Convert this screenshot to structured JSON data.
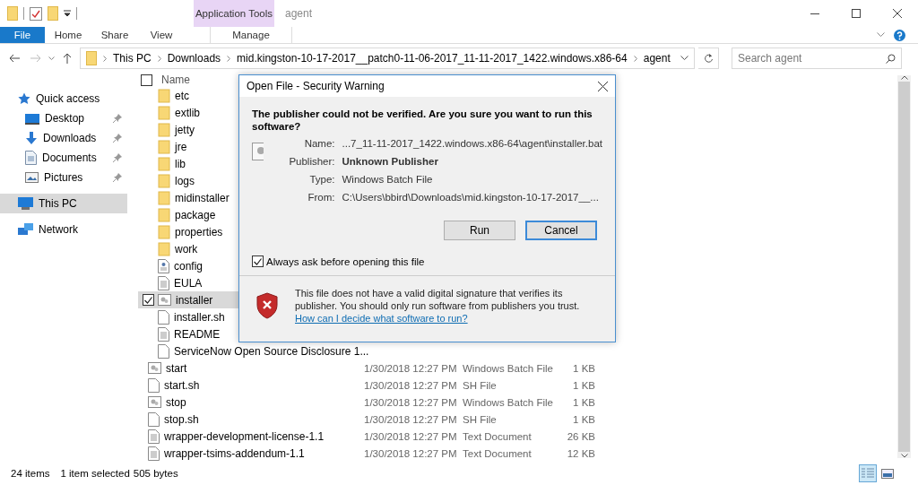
{
  "window": {
    "title": "agent",
    "context_group": "Application Tools"
  },
  "quick_access_toolbar": {
    "properties_checked": true
  },
  "ribbon_tabs": [
    {
      "label": "File",
      "kind": "file"
    },
    {
      "label": "Home",
      "kind": "tab"
    },
    {
      "label": "Share",
      "kind": "tab"
    },
    {
      "label": "View",
      "kind": "tab"
    },
    {
      "label": "Manage",
      "kind": "context"
    }
  ],
  "address_bar": {
    "path": [
      "This PC",
      "Downloads",
      "mid.kingston-10-17-2017__patch0-11-06-2017_11-11-2017_1422.windows.x86-64",
      "agent"
    ]
  },
  "search": {
    "placeholder": "Search agent"
  },
  "sidebar": {
    "items": [
      {
        "label": "Quick access",
        "kind": "star",
        "pinned": false,
        "selected": false
      },
      {
        "label": "Desktop",
        "kind": "desktop",
        "pinned": true,
        "selected": false
      },
      {
        "label": "Downloads",
        "kind": "downloads",
        "pinned": true,
        "selected": false
      },
      {
        "label": "Documents",
        "kind": "documents",
        "pinned": true,
        "selected": false
      },
      {
        "label": "Pictures",
        "kind": "pictures",
        "pinned": true,
        "selected": false
      },
      {
        "label": "This PC",
        "kind": "pc",
        "pinned": false,
        "selected": true
      },
      {
        "label": "Network",
        "kind": "network",
        "pinned": false,
        "selected": false
      }
    ]
  },
  "file_list": {
    "columns": [
      "Name"
    ],
    "select_all_checked": false,
    "rows": [
      {
        "name": "etc",
        "kind": "folder",
        "selected": false
      },
      {
        "name": "extlib",
        "kind": "folder",
        "selected": false
      },
      {
        "name": "jetty",
        "kind": "folder",
        "selected": false
      },
      {
        "name": "jre",
        "kind": "folder",
        "selected": false
      },
      {
        "name": "lib",
        "kind": "folder",
        "selected": false
      },
      {
        "name": "logs",
        "kind": "folder",
        "selected": false
      },
      {
        "name": "midinstaller",
        "kind": "folder",
        "selected": false
      },
      {
        "name": "package",
        "kind": "folder",
        "selected": false
      },
      {
        "name": "properties",
        "kind": "folder",
        "selected": false
      },
      {
        "name": "work",
        "kind": "folder",
        "selected": false
      },
      {
        "name": "config",
        "kind": "settings",
        "selected": false
      },
      {
        "name": "EULA",
        "kind": "text",
        "selected": false
      },
      {
        "name": "installer",
        "kind": "batch",
        "selected": true
      },
      {
        "name": "installer.sh",
        "kind": "blank",
        "selected": false
      },
      {
        "name": "README",
        "kind": "text",
        "selected": false
      },
      {
        "name": "ServiceNow Open Source Disclosure 1...",
        "kind": "blank",
        "selected": false
      },
      {
        "name": "start",
        "kind": "batch",
        "selected": false,
        "date": "1/30/2018 12:27 PM",
        "type": "Windows Batch File",
        "size": "1 KB"
      },
      {
        "name": "start.sh",
        "kind": "blank",
        "selected": false,
        "date": "1/30/2018 12:27 PM",
        "type": "SH File",
        "size": "1 KB"
      },
      {
        "name": "stop",
        "kind": "batch",
        "selected": false,
        "date": "1/30/2018 12:27 PM",
        "type": "Windows Batch File",
        "size": "1 KB"
      },
      {
        "name": "stop.sh",
        "kind": "blank",
        "selected": false,
        "date": "1/30/2018 12:27 PM",
        "type": "SH File",
        "size": "1 KB"
      },
      {
        "name": "wrapper-development-license-1.1",
        "kind": "text",
        "selected": false,
        "date": "1/30/2018 12:27 PM",
        "type": "Text Document",
        "size": "26 KB"
      },
      {
        "name": "wrapper-tsims-addendum-1.1",
        "kind": "text",
        "selected": false,
        "date": "1/30/2018 12:27 PM",
        "type": "Text Document",
        "size": "12 KB"
      }
    ]
  },
  "status_bar": {
    "item_count": "24 items",
    "selection": "1 item selected",
    "size": "505 bytes",
    "views": [
      {
        "kind": "details",
        "selected": true
      },
      {
        "kind": "large",
        "selected": false
      }
    ]
  },
  "dialog": {
    "title": "Open File - Security Warning",
    "heading": "The publisher could not be verified.  Are you sure you want to run this software?",
    "fields": [
      {
        "label": "Name:",
        "value": "...7_11-11-2017_1422.windows.x86-64\\agent\\installer.bat",
        "bold": false
      },
      {
        "label": "Publisher:",
        "value": "Unknown Publisher",
        "bold": true
      },
      {
        "label": "Type:",
        "value": "Windows Batch File",
        "bold": false
      },
      {
        "label": "From:",
        "value": "C:\\Users\\bbird\\Downloads\\mid.kingston-10-17-2017__...",
        "bold": false
      }
    ],
    "buttons": [
      {
        "label": "Run",
        "focused": false
      },
      {
        "label": "Cancel",
        "focused": true
      }
    ],
    "checkbox": {
      "label": "Always ask before opening this file",
      "checked": true
    },
    "warning": "This file does not have a valid digital signature that verifies its publisher.  You should only run software from publishers you trust.",
    "link": "How can I decide what software to run?"
  }
}
